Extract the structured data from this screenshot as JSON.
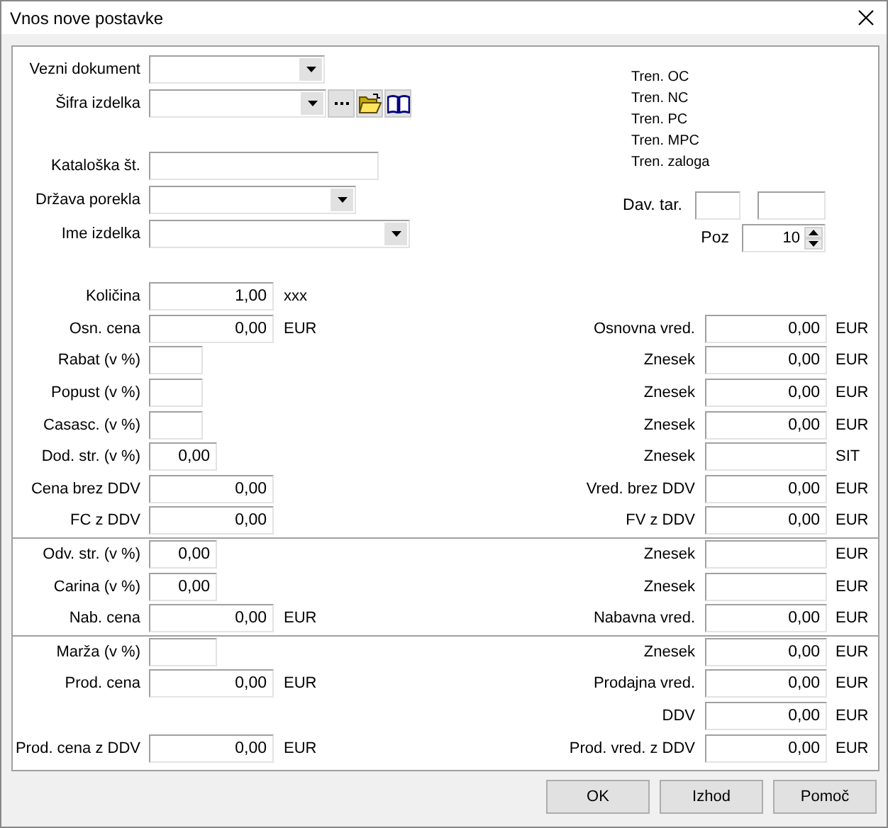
{
  "window": {
    "title": "Vnos nove postavke"
  },
  "header_fields": [
    {
      "label": "Vezni dokument",
      "kind": "combo"
    },
    {
      "label": "Šifra izdelka",
      "kind": "lookup"
    },
    {
      "label": "Kataloška št.",
      "kind": "text"
    },
    {
      "label": "Država porekla",
      "kind": "combo"
    },
    {
      "label": "Ime izdelka",
      "kind": "combo"
    }
  ],
  "current_values": [
    "Tren. OC",
    "Tren. NC",
    "Tren. PC",
    "Tren. MPC",
    "Tren. zaloga"
  ],
  "tax_rate": {
    "label": "Dav. tar."
  },
  "position": {
    "label": "Poz",
    "value": "10"
  },
  "sections": [
    [
      {
        "left": {
          "label": "Količina",
          "value": "1,00",
          "unit": "xxx",
          "kind": "wide"
        }
      },
      {
        "left": {
          "label": "Osn. cena",
          "value": "0,00",
          "unit": "EUR",
          "kind": "wide"
        },
        "right": {
          "label": "Osnovna vred.",
          "value": "0,00",
          "unit": "EUR"
        }
      },
      {
        "left": {
          "label": "Rabat (v %)",
          "kind": "small"
        },
        "right": {
          "label": "Znesek",
          "value": "0,00",
          "unit": "EUR"
        }
      },
      {
        "left": {
          "label": "Popust (v %)",
          "kind": "small"
        },
        "right": {
          "label": "Znesek",
          "value": "0,00",
          "unit": "EUR"
        }
      },
      {
        "left": {
          "label": "Casasc. (v %)",
          "kind": "small"
        },
        "right": {
          "label": "Znesek",
          "value": "0,00",
          "unit": "EUR"
        }
      },
      {
        "left": {
          "label": "Dod. str. (v %)",
          "value": "0,00",
          "kind": "medium"
        },
        "right": {
          "label": "Znesek",
          "unit": "SIT"
        }
      },
      {
        "left": {
          "label": "Cena brez DDV",
          "value": "0,00",
          "kind": "wide"
        },
        "right": {
          "label": "Vred. brez DDV",
          "value": "0,00",
          "unit": "EUR"
        }
      },
      {
        "left": {
          "label": "FC z DDV",
          "value": "0,00",
          "kind": "wide"
        },
        "right": {
          "label": "FV z DDV",
          "value": "0,00",
          "unit": "EUR"
        }
      }
    ],
    [
      {
        "left": {
          "label": "Odv. str. (v %)",
          "value": "0,00",
          "kind": "medium"
        },
        "right": {
          "label": "Znesek",
          "unit": "EUR"
        }
      },
      {
        "left": {
          "label": "Carina (v %)",
          "value": "0,00",
          "kind": "medium"
        },
        "right": {
          "label": "Znesek",
          "unit": "EUR"
        }
      },
      {
        "left": {
          "label": "Nab. cena",
          "value": "0,00",
          "unit": "EUR",
          "kind": "wide"
        },
        "right": {
          "label": "Nabavna vred.",
          "value": "0,00",
          "unit": "EUR"
        }
      }
    ],
    [
      {
        "left": {
          "label": "Marža (v %)",
          "kind": "medium"
        },
        "right": {
          "label": "Znesek",
          "value": "0,00",
          "unit": "EUR"
        }
      },
      {
        "left": {
          "label": "Prod. cena",
          "value": "0,00",
          "unit": "EUR",
          "kind": "wide"
        },
        "right": {
          "label": "Prodajna vred.",
          "value": "0,00",
          "unit": "EUR"
        }
      },
      {
        "right": {
          "label": "DDV",
          "value": "0,00",
          "unit": "EUR"
        }
      },
      {
        "left": {
          "label": "Prod. cena z DDV",
          "value": "0,00",
          "unit": "EUR",
          "kind": "wide"
        },
        "right": {
          "label": "Prod. vred. z DDV",
          "value": "0,00",
          "unit": "EUR"
        }
      }
    ]
  ],
  "buttons": [
    "OK",
    "Izhod",
    "Pomoč"
  ]
}
